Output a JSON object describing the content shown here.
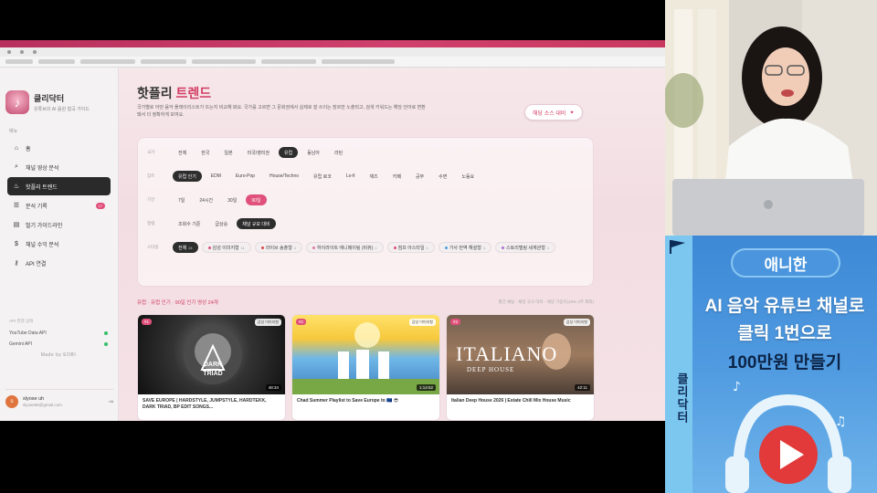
{
  "app": {
    "brand_name": "클리닥터",
    "brand_sub": "유튜브의 AI 음원 협곡 가이드",
    "nav_section": "메뉴",
    "nav": [
      {
        "label": "홈",
        "icon": "home-icon",
        "glyph": "⌂"
      },
      {
        "label": "채널 영상 분석",
        "icon": "search-icon",
        "glyph": "⌕"
      },
      {
        "label": "핫플리 트렌드",
        "icon": "fire-icon",
        "glyph": "♨",
        "active": true
      },
      {
        "label": "분석 기록",
        "icon": "history-icon",
        "glyph": "☰",
        "badge": "17"
      },
      {
        "label": "벌기 가이드라인",
        "icon": "document-icon",
        "glyph": "▤"
      },
      {
        "label": "채널 수익 분석",
        "icon": "dollar-icon",
        "glyph": "$"
      },
      {
        "label": "API 연결",
        "icon": "key-icon",
        "glyph": "⚷"
      }
    ],
    "api_title": "API 연결 상태",
    "api": [
      {
        "label": "YouTube Data API"
      },
      {
        "label": "Gemini API"
      }
    ],
    "made_by": "Made by EOBI",
    "user": {
      "avatar": "s",
      "name": "slyose uh",
      "email": "slyose65@gmail.com"
    }
  },
  "page": {
    "title_main": "핫플리",
    "title_accent": "트렌드",
    "description": "국가별로 어떤 음악 플레이리스트가 뜨는지 비교해 봐요. 국가를 고르면 그 문화권에서 실제로 잘 쓰이는 장르만 노출되고, 검색 키워드는 해당 언어로 변환돼서 더 정확하게 보여요.",
    "feature_button": "해당 소스 대비",
    "filters": {
      "country": {
        "label": "국가",
        "options": [
          "전체",
          "한국",
          "일본",
          "미국/영미권",
          "유럽",
          "동남아",
          "라틴"
        ],
        "selected": "유럽"
      },
      "genre": {
        "label": "장르",
        "options": [
          "유럽 인기",
          "EDM",
          "Euro-Pop",
          "House/Techno",
          "유럽 로코",
          "Lo-fi",
          "재즈",
          "카페",
          "공부",
          "수면",
          "노동요"
        ],
        "selected": "유럽 인기"
      },
      "period": {
        "label": "기간",
        "options": [
          "7일",
          "24시간",
          "30일",
          "90일"
        ],
        "selected": "90일"
      },
      "sort": {
        "label": "정렬",
        "options": [
          "조회수 기준",
          "급상승",
          "채널 규모 대비"
        ],
        "selected": "채널 규모 대비"
      },
      "style": {
        "label": "스타일",
        "options": [
          {
            "label": "전체",
            "count": "24",
            "color": "#2d2d2d"
          },
          {
            "label": "감성 이미지형",
            "count": "11",
            "color": "#e0507a"
          },
          {
            "label": "라이브 송출형",
            "count": "1",
            "color": "#e04848"
          },
          {
            "label": "하이라이트 애니메이팅 (비쥬)",
            "count": "1",
            "color": "#e07aa0"
          },
          {
            "label": "점프 아스타일",
            "count": "1",
            "color": "#e0507a"
          },
          {
            "label": "가사 번역 해설형",
            "count": "1",
            "color": "#4aa0e0"
          },
          {
            "label": "스토리텔링 세계관형",
            "count": "1",
            "color": "#b070d0"
          }
        ],
        "selected": "전체"
      }
    },
    "results_left": "유럽 · 유럽 인기 · 90일 인기 영상 24개",
    "results_right": "월간 채팅 · 채널 규모 대비 · 채널 가중치(10% 4주 제외)",
    "cards": [
      {
        "rank": "#1",
        "tag": "감성 이미지형",
        "duration": "48:34",
        "title": "SAVE EUROPE | HARDSTYLE, JUMPSTYLE, HARDTEKK, DARK TRIAD, BP EDIT SONGS..."
      },
      {
        "rank": "#2",
        "tag": "감성 이미지형",
        "duration": "1:14:52",
        "title": "Chad Summer Playlist to Save Europe to 🇪🇺 😎"
      },
      {
        "rank": "#3",
        "tag": "감성 이미지형",
        "duration": "42:11",
        "title": "Italian Deep House 2026 | Estate Chill Mix House Music",
        "thumb_text": "ITALIANO",
        "thumb_sub": "DEEP HOUSE"
      }
    ]
  },
  "ad": {
    "pill": "애니한",
    "line1": "AI 음악 유튜브 채널로",
    "line2": "클릭 1번으로",
    "line3": "100만원 만들기",
    "side_text": "클리닥터"
  }
}
